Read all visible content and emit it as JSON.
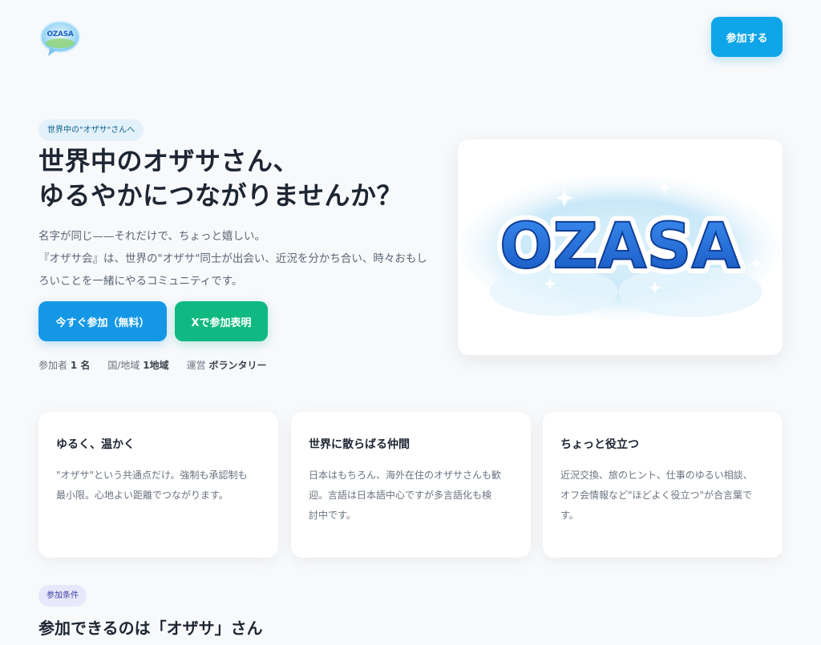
{
  "header": {
    "logo_text": "OZASA",
    "join_label": "参加する"
  },
  "hero": {
    "badge": "世界中の\"オザサ\"さんへ",
    "title_lines": [
      "世界中のオザサさん、",
      "ゆるやかにつながりませんか？"
    ],
    "desc_lines": [
      "名字が同じ——それだけで、ちょっと嬉しい。",
      "『オザサ会』は、世界の\"オザサ\"同士が出会い、近況を分かち合い、時々おもし",
      "ろいことを一緒にやるコミュニティです。"
    ],
    "cta_primary": "今すぐ参加（無料）",
    "cta_x": "Xで参加表明",
    "stats": [
      {
        "label": "参加者",
        "value": "1 名"
      },
      {
        "label": "国/地域",
        "value": "1地域"
      },
      {
        "label": "運営",
        "value": "ボランタリー"
      }
    ],
    "image_text": "OZASA"
  },
  "features": [
    {
      "title": "ゆるく、温かく",
      "lines": [
        "\"オザサ\"という共通点だけ。強制も承認制も",
        "最小限。心地よい距離でつながります。"
      ]
    },
    {
      "title": "世界に散らばる仲間",
      "lines": [
        "日本はもちろん、海外在住のオザサさんも歓",
        "迎。言語は日本語中心ですが多言語化も検",
        "討中です。"
      ]
    },
    {
      "title": "ちょっと役立つ",
      "lines": [
        "近況交換、旅のヒント、仕事のゆるい相談、",
        "オフ会情報など\"ほどよく役立つ\"が合言葉で",
        "す。"
      ]
    }
  ],
  "requirements": {
    "badge": "参加条件",
    "title": "参加できるのは「オザサ」さん"
  },
  "colors": {
    "primary": "#1498e6",
    "x_green": "#10b981",
    "background": "#f8f9fb"
  }
}
